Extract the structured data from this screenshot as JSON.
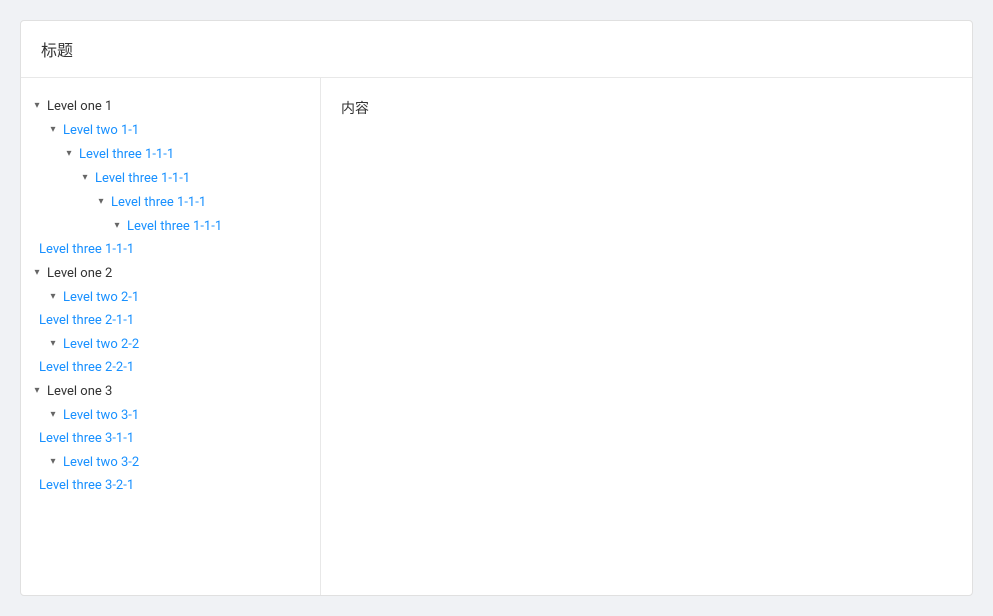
{
  "header": {
    "title": "标题"
  },
  "content": {
    "text": "内容"
  },
  "tree": [
    {
      "id": "l1",
      "label": "Level one 1",
      "indent": 0,
      "expanded": true,
      "children": [
        {
          "id": "l1-2-1",
          "label": "Level two 1-1",
          "indent": 1,
          "expanded": true,
          "children": [
            {
              "id": "l1-3-1",
              "label": "Level three 1-1-1",
              "indent": 2,
              "expanded": true,
              "children": [
                {
                  "id": "l1-3-2",
                  "label": "Level three 1-1-1",
                  "indent": 3,
                  "expanded": true,
                  "children": [
                    {
                      "id": "l1-3-3",
                      "label": "Level three 1-1-1",
                      "indent": 4,
                      "expanded": true,
                      "children": [
                        {
                          "id": "l1-3-4",
                          "label": "Level three 1-1-1",
                          "indent": 5,
                          "expanded": true,
                          "children": [
                            {
                              "id": "l1-3-leaf",
                              "label": "Level three 1-1-1",
                              "indent": 6,
                              "leaf": true
                            }
                          ]
                        }
                      ]
                    }
                  ]
                }
              ]
            }
          ]
        }
      ]
    },
    {
      "id": "l2",
      "label": "Level one 2",
      "indent": 0,
      "expanded": true,
      "children": [
        {
          "id": "l2-2-1",
          "label": "Level two 2-1",
          "indent": 1,
          "expanded": true,
          "children": [
            {
              "id": "l2-3-1",
              "label": "Level three 2-1-1",
              "indent": 2,
              "leaf": true
            }
          ]
        },
        {
          "id": "l2-2-2",
          "label": "Level two 2-2",
          "indent": 1,
          "expanded": true,
          "children": [
            {
              "id": "l2-3-2",
              "label": "Level three 2-2-1",
              "indent": 2,
              "leaf": true
            }
          ]
        }
      ]
    },
    {
      "id": "l3",
      "label": "Level one 3",
      "indent": 0,
      "expanded": true,
      "children": [
        {
          "id": "l3-2-1",
          "label": "Level two 3-1",
          "indent": 1,
          "expanded": true,
          "children": [
            {
              "id": "l3-3-1",
              "label": "Level three 3-1-1",
              "indent": 2,
              "leaf": true
            }
          ]
        },
        {
          "id": "l3-2-2",
          "label": "Level two 3-2",
          "indent": 1,
          "expanded": true,
          "children": [
            {
              "id": "l3-3-2",
              "label": "Level three 3-2-1",
              "indent": 2,
              "leaf": true
            }
          ]
        }
      ]
    }
  ]
}
